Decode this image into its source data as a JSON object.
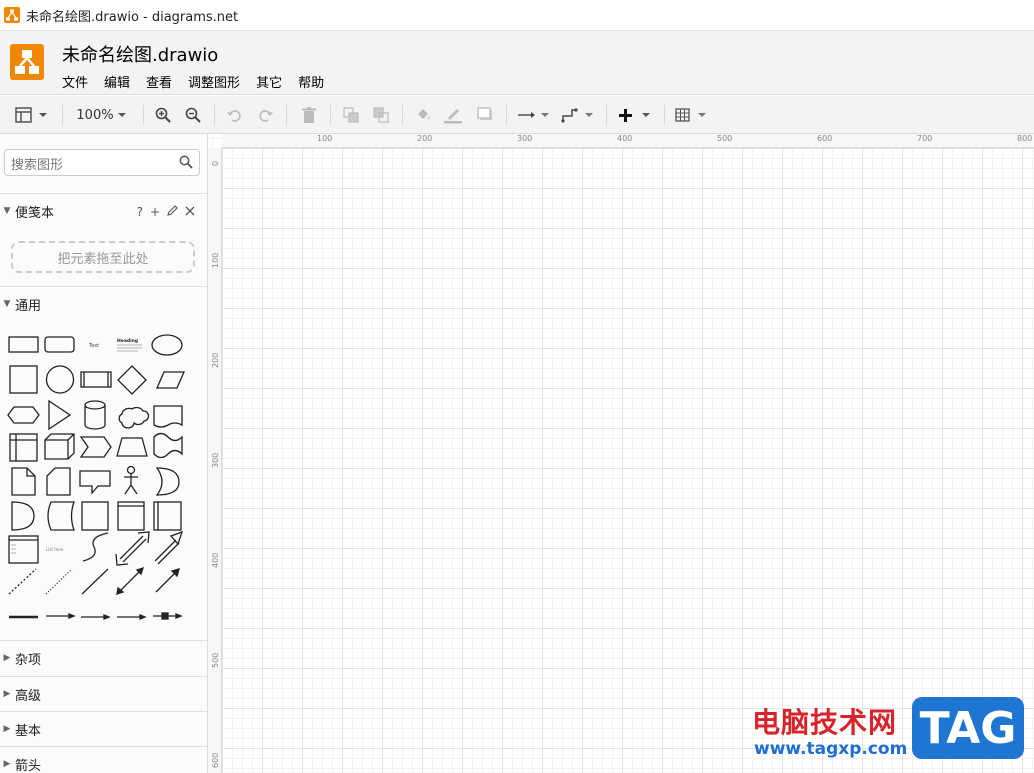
{
  "window": {
    "title": "未命名绘图.drawio - diagrams.net"
  },
  "header": {
    "doc_title": "未命名绘图.drawio",
    "menu": [
      "文件",
      "编辑",
      "查看",
      "调整图形",
      "其它",
      "帮助"
    ]
  },
  "toolbar": {
    "zoom": "100%",
    "icons": [
      "format-panel-icon",
      "zoom-in-icon",
      "zoom-out-icon",
      "undo-icon",
      "redo-icon",
      "delete-icon",
      "to-front-icon",
      "to-back-icon",
      "fill-color-icon",
      "line-color-icon",
      "shadow-icon",
      "connection-icon",
      "waypoints-icon",
      "insert-icon",
      "table-icon"
    ]
  },
  "sidebar": {
    "search_placeholder": "搜索图形",
    "scratchpad": {
      "label": "便笺本",
      "help": "?",
      "add": "+",
      "drop_text": "把元素拖至此处"
    },
    "general": {
      "label": "通用"
    },
    "shape_texts": {
      "text": "Text",
      "heading": "Heading",
      "list_item": "List Item"
    },
    "collapsed_sections": [
      "杂项",
      "高级",
      "基本",
      "箭头"
    ]
  },
  "canvas": {
    "hruler_labels": [
      "100",
      "200",
      "300",
      "400",
      "500",
      "600",
      "700",
      "800"
    ],
    "vruler_labels": [
      "0",
      "100",
      "200",
      "300",
      "400",
      "500",
      "600"
    ]
  },
  "watermark": {
    "cn": "电脑技术网",
    "tag": "TAG",
    "url": "www.tagxp.com"
  },
  "colors": {
    "brand": "#f08705",
    "toolbar_bg": "#f1f3f4",
    "watermark_red": "#d9232a",
    "watermark_blue": "#1f76d2"
  }
}
